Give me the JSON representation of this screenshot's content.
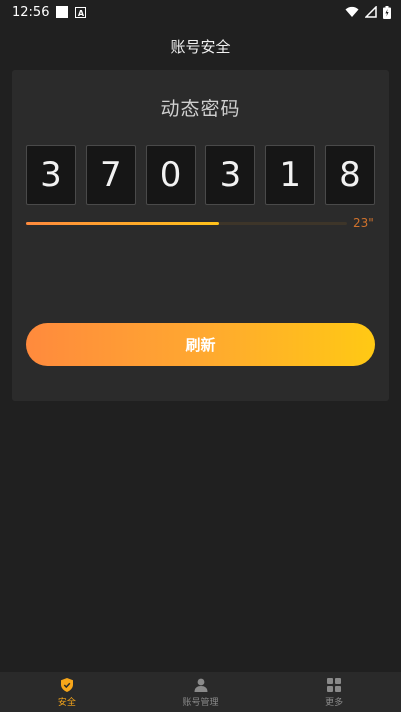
{
  "status_bar": {
    "time": "12:56",
    "notification_glyph": "A"
  },
  "header": {
    "title": "账号安全"
  },
  "otp": {
    "title": "动态密码",
    "digits": [
      "3",
      "7",
      "0",
      "3",
      "1",
      "8"
    ],
    "remaining_fraction": 0.6,
    "remaining_text": "23\"",
    "refresh_label": "刷新"
  },
  "colors": {
    "accent_start": "#ff8a3d",
    "accent_end": "#ffc914",
    "active_tab": "#f7a61a"
  },
  "nav": {
    "items": [
      {
        "label": "安全",
        "icon": "shield-icon",
        "active": true
      },
      {
        "label": "账号管理",
        "icon": "person-icon",
        "active": false
      },
      {
        "label": "更多",
        "icon": "grid-icon",
        "active": false
      }
    ]
  }
}
